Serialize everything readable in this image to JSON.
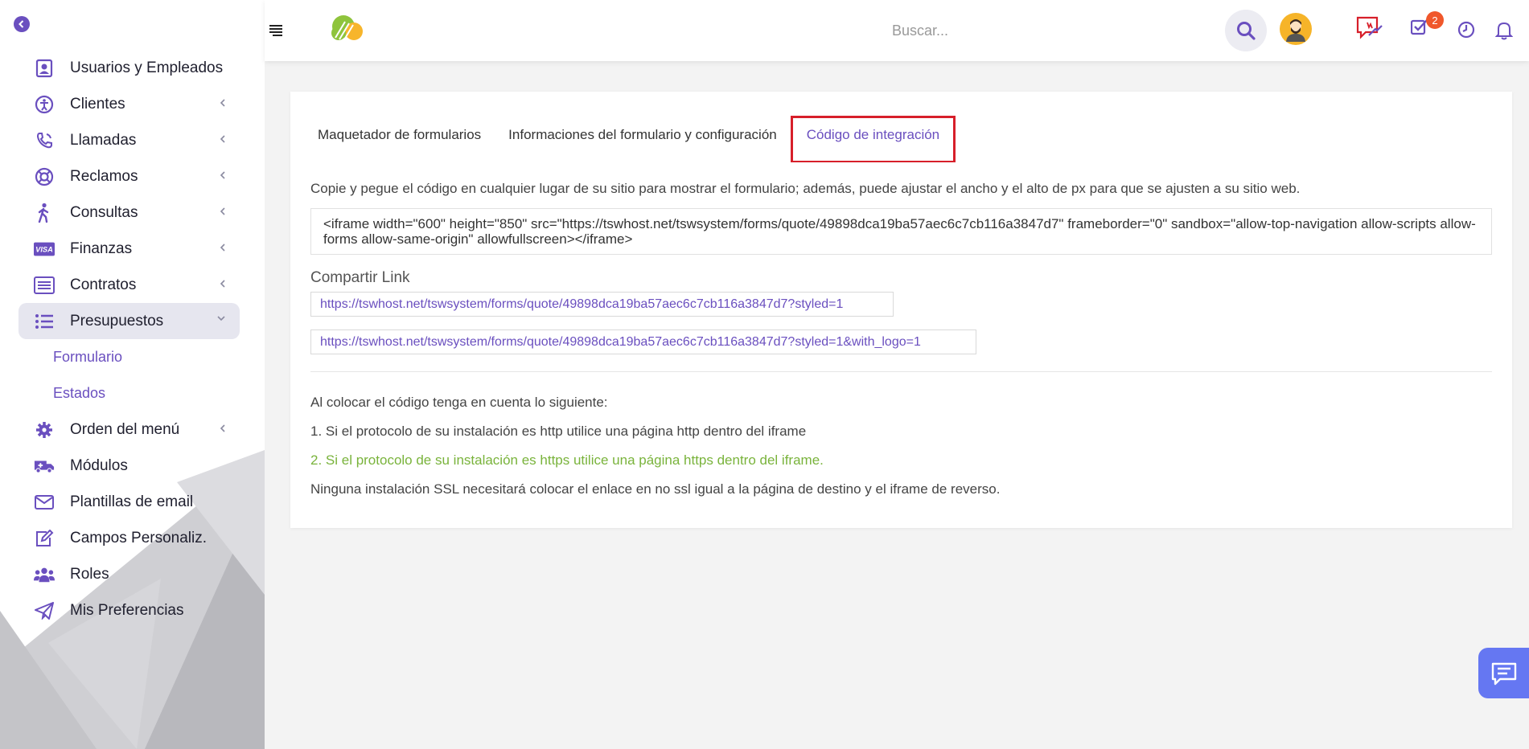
{
  "sidebar": {
    "items": [
      {
        "label": "Usuarios y Empleados",
        "icon": "user-badge-icon",
        "has_chevron": false
      },
      {
        "label": "Clientes",
        "icon": "accessibility-icon",
        "has_chevron": true
      },
      {
        "label": "Llamadas",
        "icon": "phone-icon",
        "has_chevron": true
      },
      {
        "label": "Reclamos",
        "icon": "lifebuoy-icon",
        "has_chevron": true
      },
      {
        "label": "Consultas",
        "icon": "person-walking-icon",
        "has_chevron": true
      },
      {
        "label": "Finanzas",
        "icon": "visa-card-icon",
        "has_chevron": true
      },
      {
        "label": "Contratos",
        "icon": "list-alt-icon",
        "has_chevron": true
      },
      {
        "label": "Presupuestos",
        "icon": "list-icon",
        "has_chevron": true
      },
      {
        "label": "Orden del menú",
        "icon": "gear-icon",
        "has_chevron": true
      },
      {
        "label": "Módulos",
        "icon": "ambulance-icon",
        "has_chevron": false
      },
      {
        "label": "Plantillas de email",
        "icon": "envelope-icon",
        "has_chevron": false
      },
      {
        "label": "Campos Personaliz.",
        "icon": "edit-icon",
        "has_chevron": false
      },
      {
        "label": "Roles",
        "icon": "users-icon",
        "has_chevron": false
      },
      {
        "label": "Mis Preferencias",
        "icon": "paper-plane-icon",
        "has_chevron": false
      }
    ],
    "subitems": [
      "Formulario",
      "Estados"
    ]
  },
  "topbar": {
    "search_placeholder": "Buscar...",
    "task_badge": "2"
  },
  "tabs": [
    {
      "label": "Maquetador de formularios"
    },
    {
      "label": "Informaciones del formulario y configuración"
    },
    {
      "label": "Código de integración"
    }
  ],
  "integration": {
    "description": "Copie y pegue el código en cualquier lugar de su sitio para mostrar el formulario; además, puede ajustar el ancho y el alto de px para que se ajusten a su sitio web.",
    "code": "<iframe width=\"600\" height=\"850\" src=\"https://tswhost.net/tswsystem/forms/quote/49898dca19ba57aec6c7cb116a3847d7\" frameborder=\"0\" sandbox=\"allow-top-navigation allow-scripts allow-forms allow-same-origin\" allowfullscreen></iframe>",
    "share_title": "Compartir Link",
    "link_styled": "https://tswhost.net/tswsystem/forms/quote/49898dca19ba57aec6c7cb116a3847d7?styled=1",
    "link_styled_logo": "https://tswhost.net/tswsystem/forms/quote/49898dca19ba57aec6c7cb116a3847d7?styled=1&with_logo=1",
    "notes": {
      "intro": "Al colocar el código tenga en cuenta lo siguiente:",
      "http": "1. Si el protocolo de su instalación es http utilice una página http dentro del iframe",
      "https": "2. Si el protocolo de su instalación es https utilice una página https dentro del iframe.",
      "ssl": "Ninguna instalación SSL necesitará colocar el enlace en no ssl igual a la página de destino y el iframe de reverso."
    }
  },
  "colors": {
    "accent": "#6a4fbf",
    "highlight_border": "#d71f2a",
    "green_note": "#79b33b",
    "chat_button": "#6577f2"
  }
}
